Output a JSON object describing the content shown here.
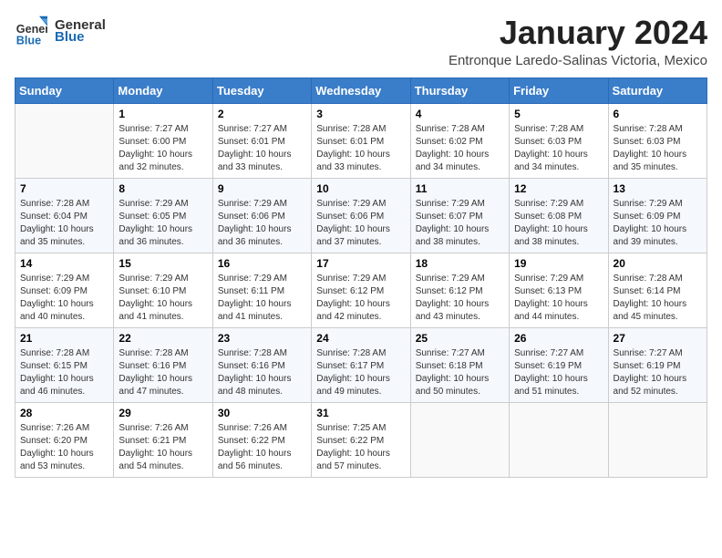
{
  "logo": {
    "general": "General",
    "blue": "Blue"
  },
  "header": {
    "month_year": "January 2024",
    "location": "Entronque Laredo-Salinas Victoria, Mexico"
  },
  "days_of_week": [
    "Sunday",
    "Monday",
    "Tuesday",
    "Wednesday",
    "Thursday",
    "Friday",
    "Saturday"
  ],
  "weeks": [
    [
      {
        "day": "",
        "info": ""
      },
      {
        "day": "1",
        "info": "Sunrise: 7:27 AM\nSunset: 6:00 PM\nDaylight: 10 hours and 32 minutes."
      },
      {
        "day": "2",
        "info": "Sunrise: 7:27 AM\nSunset: 6:01 PM\nDaylight: 10 hours and 33 minutes."
      },
      {
        "day": "3",
        "info": "Sunrise: 7:28 AM\nSunset: 6:01 PM\nDaylight: 10 hours and 33 minutes."
      },
      {
        "day": "4",
        "info": "Sunrise: 7:28 AM\nSunset: 6:02 PM\nDaylight: 10 hours and 34 minutes."
      },
      {
        "day": "5",
        "info": "Sunrise: 7:28 AM\nSunset: 6:03 PM\nDaylight: 10 hours and 34 minutes."
      },
      {
        "day": "6",
        "info": "Sunrise: 7:28 AM\nSunset: 6:03 PM\nDaylight: 10 hours and 35 minutes."
      }
    ],
    [
      {
        "day": "7",
        "info": "Sunrise: 7:28 AM\nSunset: 6:04 PM\nDaylight: 10 hours and 35 minutes."
      },
      {
        "day": "8",
        "info": "Sunrise: 7:29 AM\nSunset: 6:05 PM\nDaylight: 10 hours and 36 minutes."
      },
      {
        "day": "9",
        "info": "Sunrise: 7:29 AM\nSunset: 6:06 PM\nDaylight: 10 hours and 36 minutes."
      },
      {
        "day": "10",
        "info": "Sunrise: 7:29 AM\nSunset: 6:06 PM\nDaylight: 10 hours and 37 minutes."
      },
      {
        "day": "11",
        "info": "Sunrise: 7:29 AM\nSunset: 6:07 PM\nDaylight: 10 hours and 38 minutes."
      },
      {
        "day": "12",
        "info": "Sunrise: 7:29 AM\nSunset: 6:08 PM\nDaylight: 10 hours and 38 minutes."
      },
      {
        "day": "13",
        "info": "Sunrise: 7:29 AM\nSunset: 6:09 PM\nDaylight: 10 hours and 39 minutes."
      }
    ],
    [
      {
        "day": "14",
        "info": "Sunrise: 7:29 AM\nSunset: 6:09 PM\nDaylight: 10 hours and 40 minutes."
      },
      {
        "day": "15",
        "info": "Sunrise: 7:29 AM\nSunset: 6:10 PM\nDaylight: 10 hours and 41 minutes."
      },
      {
        "day": "16",
        "info": "Sunrise: 7:29 AM\nSunset: 6:11 PM\nDaylight: 10 hours and 41 minutes."
      },
      {
        "day": "17",
        "info": "Sunrise: 7:29 AM\nSunset: 6:12 PM\nDaylight: 10 hours and 42 minutes."
      },
      {
        "day": "18",
        "info": "Sunrise: 7:29 AM\nSunset: 6:12 PM\nDaylight: 10 hours and 43 minutes."
      },
      {
        "day": "19",
        "info": "Sunrise: 7:29 AM\nSunset: 6:13 PM\nDaylight: 10 hours and 44 minutes."
      },
      {
        "day": "20",
        "info": "Sunrise: 7:28 AM\nSunset: 6:14 PM\nDaylight: 10 hours and 45 minutes."
      }
    ],
    [
      {
        "day": "21",
        "info": "Sunrise: 7:28 AM\nSunset: 6:15 PM\nDaylight: 10 hours and 46 minutes."
      },
      {
        "day": "22",
        "info": "Sunrise: 7:28 AM\nSunset: 6:16 PM\nDaylight: 10 hours and 47 minutes."
      },
      {
        "day": "23",
        "info": "Sunrise: 7:28 AM\nSunset: 6:16 PM\nDaylight: 10 hours and 48 minutes."
      },
      {
        "day": "24",
        "info": "Sunrise: 7:28 AM\nSunset: 6:17 PM\nDaylight: 10 hours and 49 minutes."
      },
      {
        "day": "25",
        "info": "Sunrise: 7:27 AM\nSunset: 6:18 PM\nDaylight: 10 hours and 50 minutes."
      },
      {
        "day": "26",
        "info": "Sunrise: 7:27 AM\nSunset: 6:19 PM\nDaylight: 10 hours and 51 minutes."
      },
      {
        "day": "27",
        "info": "Sunrise: 7:27 AM\nSunset: 6:19 PM\nDaylight: 10 hours and 52 minutes."
      }
    ],
    [
      {
        "day": "28",
        "info": "Sunrise: 7:26 AM\nSunset: 6:20 PM\nDaylight: 10 hours and 53 minutes."
      },
      {
        "day": "29",
        "info": "Sunrise: 7:26 AM\nSunset: 6:21 PM\nDaylight: 10 hours and 54 minutes."
      },
      {
        "day": "30",
        "info": "Sunrise: 7:26 AM\nSunset: 6:22 PM\nDaylight: 10 hours and 56 minutes."
      },
      {
        "day": "31",
        "info": "Sunrise: 7:25 AM\nSunset: 6:22 PM\nDaylight: 10 hours and 57 minutes."
      },
      {
        "day": "",
        "info": ""
      },
      {
        "day": "",
        "info": ""
      },
      {
        "day": "",
        "info": ""
      }
    ]
  ]
}
